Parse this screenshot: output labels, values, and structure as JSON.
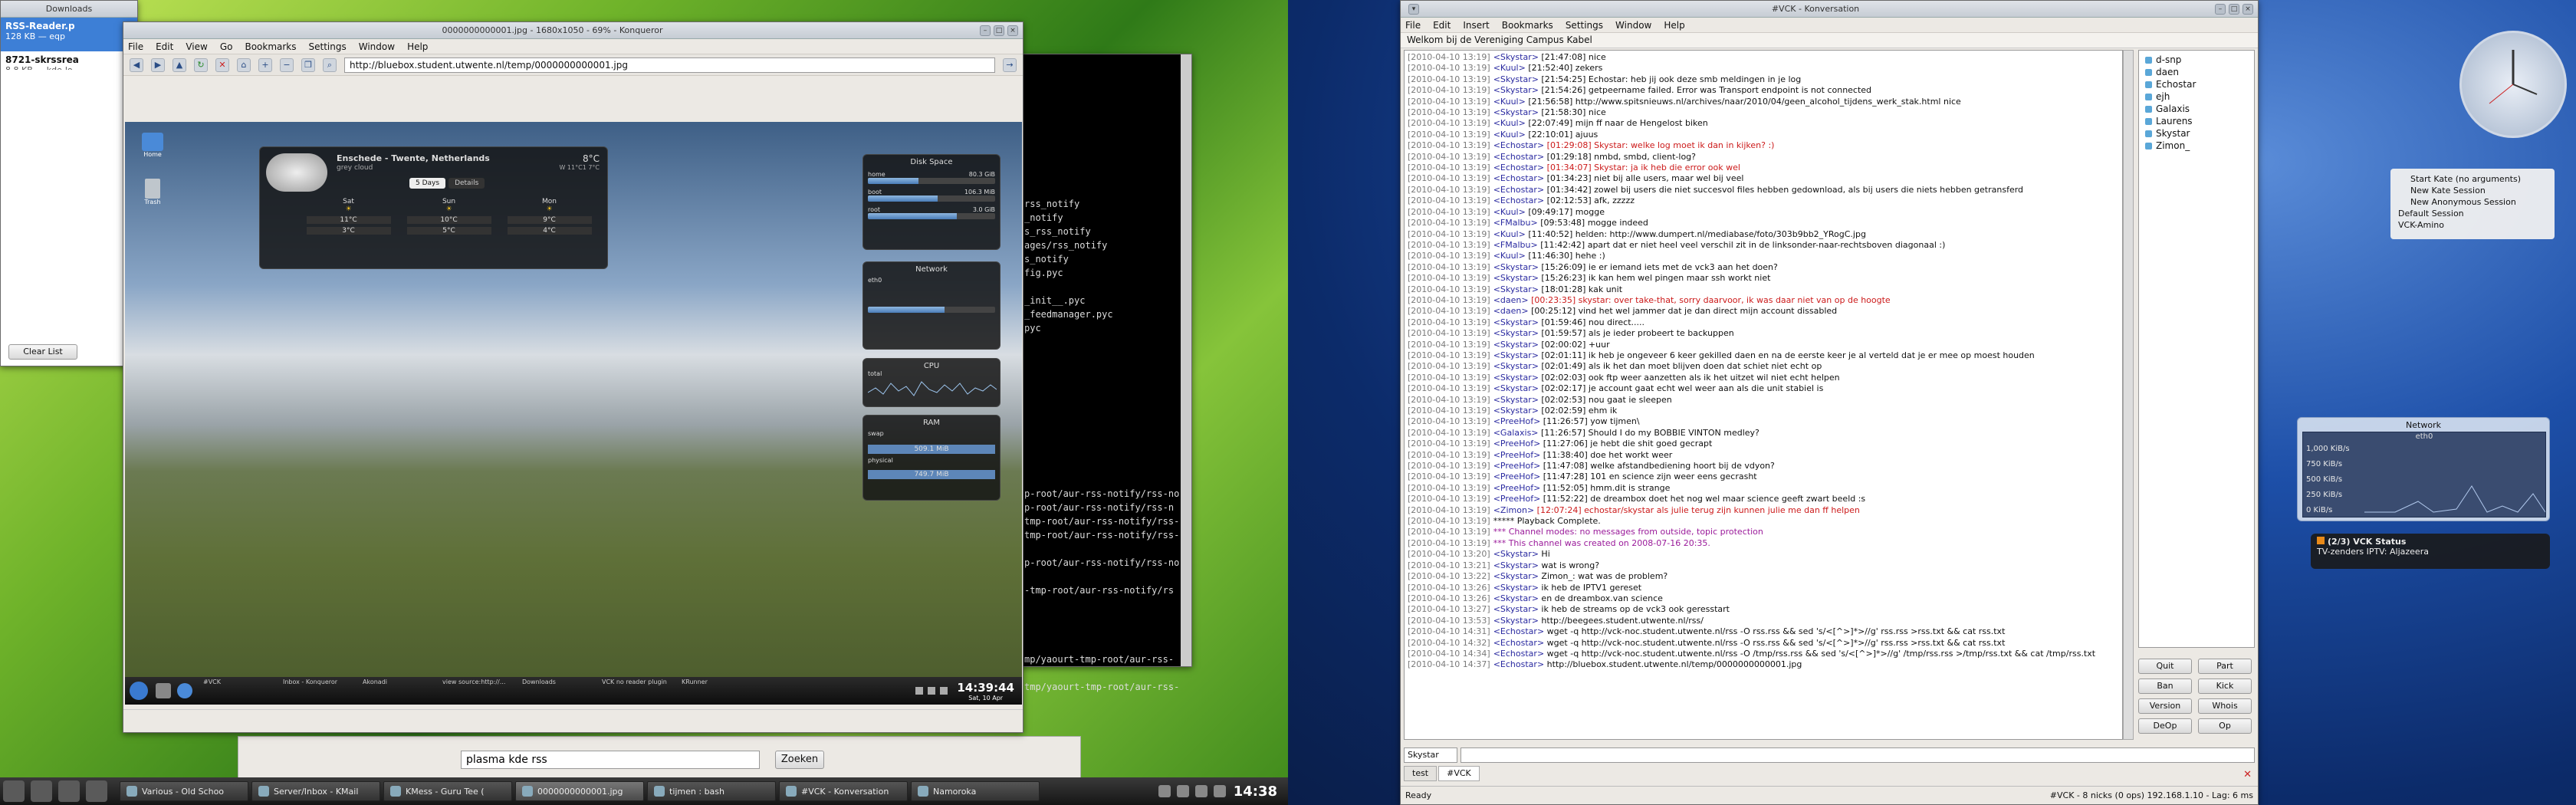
{
  "downloads": {
    "title": "Downloads",
    "items": [
      {
        "name": "RSS-Reader.p",
        "size": "128 KB — eqp"
      },
      {
        "name": "8721-skrssrea",
        "size": "8.8 KB — kde-lo"
      }
    ],
    "clear_label": "Clear List"
  },
  "konqueror": {
    "title": "0000000000001.jpg - 1680x1050 - 69% - Konqueror",
    "menu": [
      "File",
      "Edit",
      "View",
      "Go",
      "Bookmarks",
      "Settings",
      "Window",
      "Help"
    ],
    "url": "http://bluebox.student.utwente.nl/temp/0000000000001.jpg"
  },
  "thumb": {
    "weather": {
      "location": "Enschede - Twente, Netherlands",
      "condition": "grey cloud",
      "temp": "8°C",
      "wind": "W 11°C1 7°C",
      "tab1": "5 Days",
      "tab2": "Details",
      "days": [
        {
          "d": "Sat",
          "hi": "11°C",
          "lo": "3°C"
        },
        {
          "d": "Sun",
          "hi": "10°C",
          "lo": "5°C"
        },
        {
          "d": "Mon",
          "hi": "9°C",
          "lo": "4°C"
        }
      ]
    },
    "disk": {
      "title": "Disk Space",
      "rows": [
        {
          "n": "home",
          "v": "80.3 GiB"
        },
        {
          "n": "boot",
          "v": "106.3 MiB"
        },
        {
          "n": "root",
          "v": "3.0 GiB"
        }
      ]
    },
    "network": {
      "title": "Network",
      "label1": "eth0"
    },
    "cpu": {
      "title": "CPU",
      "label": "total"
    },
    "ram": {
      "title": "RAM",
      "swap": "swap",
      "swapv": "509.1 MiB",
      "physical": "physical",
      "physv": "749.7 MiB"
    },
    "clock": "14:39:44",
    "date": "Sat, 10 Apr",
    "trash": "Trash",
    "home": "Home",
    "tasks": [
      "#VCK",
      "Inbox - Konqueror",
      "Akonadi",
      "view source:http://...",
      "Downloads",
      "VCK no reader plugin",
      "KRunner"
    ]
  },
  "terminal": {
    "lines": [
      "rss_notify",
      "_notify",
      "s_rss_notify",
      "ages/rss_notify",
      "s_notify",
      "fig.pyc",
      "",
      "_init__.pyc",
      "_feedmanager.pyc",
      "pyc",
      "",
      "",
      "",
      "",
      "",
      "",
      "",
      "",
      "",
      "",
      "",
      "p-root/aur-rss-notify/rss-no",
      "p-root/aur-rss-notify/rss-n",
      "tmp-root/aur-rss-notify/rss-",
      "tmp-root/aur-rss-notify/rss-",
      "",
      "p-root/aur-rss-notify/rss-no",
      "",
      "-tmp-root/aur-rss-notify/rs",
      "",
      "",
      "",
      "",
      "mp/yaourt-tmp-root/aur-rss-",
      "",
      "tmp/yaourt-tmp-root/aur-rss-"
    ]
  },
  "search": {
    "value": "plasma kde rss",
    "button": "Zoeken"
  },
  "left_panel": {
    "tasks": [
      "Various - Old Schoo",
      "Server/Inbox - KMail",
      "KMess - Guru Tee (",
      "0000000000001.jpg",
      "tijmen : bash",
      "#VCK - Konversation",
      "Namoroka"
    ],
    "clock": "14:38"
  },
  "konversation": {
    "title": "#VCK - Konversation",
    "menu": [
      "File",
      "Edit",
      "Insert",
      "Bookmarks",
      "Settings",
      "Window",
      "Help"
    ],
    "topic": "Welkom bij de Vereniging Campus Kabel",
    "lines": [
      {
        "t": "[2010-04-10 13:19]",
        "n": "<Skystar>",
        "m": " [21:47:08] nice",
        "c": ""
      },
      {
        "t": "[2010-04-10 13:19]",
        "n": "<Kuul>",
        "m": " [21:52:40] zekers",
        "c": ""
      },
      {
        "t": "[2010-04-10 13:19]",
        "n": "<Skystar>",
        "m": " [21:54:25] Echostar: heb jij ook deze smb meldingen in je log",
        "c": ""
      },
      {
        "t": "[2010-04-10 13:19]",
        "n": "<Skystar>",
        "m": " [21:54:26] getpeername failed. Error was Transport endpoint is not connected",
        "c": ""
      },
      {
        "t": "[2010-04-10 13:19]",
        "n": "<Kuul>",
        "m": " [21:56:58] http://www.spitsnieuws.nl/archives/naar/2010/04/geen_alcohol_tijdens_werk_stak.html nice",
        "c": ""
      },
      {
        "t": "[2010-04-10 13:19]",
        "n": "<Skystar>",
        "m": " [21:58:30] nice",
        "c": ""
      },
      {
        "t": "[2010-04-10 13:19]",
        "n": "<Kuul>",
        "m": " [22:07:49] mijn ff naar de Hengelost biken",
        "c": ""
      },
      {
        "t": "[2010-04-10 13:19]",
        "n": "<Kuul>",
        "m": " [22:10:01] ajuus",
        "c": ""
      },
      {
        "t": "[2010-04-10 13:19]",
        "n": "<Echostar>",
        "m": " [01:29:08] Skystar: welke log moet ik dan in kijken? :)",
        "c": "red"
      },
      {
        "t": "[2010-04-10 13:19]",
        "n": "<Echostar>",
        "m": " [01:29:18] nmbd, smbd, client-log?",
        "c": ""
      },
      {
        "t": "[2010-04-10 13:19]",
        "n": "<Echostar>",
        "m": " [01:34:07] Skystar: ja ik heb die error ook wel",
        "c": "red"
      },
      {
        "t": "[2010-04-10 13:19]",
        "n": "<Echostar>",
        "m": " [01:34:23] niet bij alle users, maar wel bij veel",
        "c": ""
      },
      {
        "t": "[2010-04-10 13:19]",
        "n": "<Echostar>",
        "m": " [01:34:42] zowel bij users die niet succesvol files hebben gedownload, als bij users die niets hebben getransferd",
        "c": ""
      },
      {
        "t": "[2010-04-10 13:19]",
        "n": "<Echostar>",
        "m": " [02:12:53] afk, zzzzz",
        "c": ""
      },
      {
        "t": "[2010-04-10 13:19]",
        "n": "<Kuul>",
        "m": " [09:49:17] mogge",
        "c": ""
      },
      {
        "t": "[2010-04-10 13:19]",
        "n": "<FMalbu>",
        "m": " [09:53:48] mogge indeed",
        "c": ""
      },
      {
        "t": "[2010-04-10 13:19]",
        "n": "<Kuul>",
        "m": " [11:40:52] helden: http://www.dumpert.nl/mediabase/foto/303b9bb2_YRogC.jpg",
        "c": ""
      },
      {
        "t": "[2010-04-10 13:19]",
        "n": "<FMalbu>",
        "m": " [11:42:42] apart dat er niet heel veel verschil zit in de linksonder-naar-rechtsboven diagonaal :)",
        "c": ""
      },
      {
        "t": "[2010-04-10 13:19]",
        "n": "<Kuul>",
        "m": " [11:46:30] hehe :)",
        "c": ""
      },
      {
        "t": "[2010-04-10 13:19]",
        "n": "<Skystar>",
        "m": " [15:26:09] ie er iemand iets met de vck3 aan het doen?",
        "c": ""
      },
      {
        "t": "[2010-04-10 13:19]",
        "n": "<Skystar>",
        "m": " [15:26:23] ik kan hem wel pingen maar ssh workt niet",
        "c": ""
      },
      {
        "t": "[2010-04-10 13:19]",
        "n": "<Skystar>",
        "m": " [18:01:28] kak unit",
        "c": ""
      },
      {
        "t": "[2010-04-10 13:19]",
        "n": "<daen>",
        "m": " [00:23:35] skystar: over take-that, sorry daarvoor, ik was daar niet van op de hoogte",
        "c": "red"
      },
      {
        "t": "[2010-04-10 13:19]",
        "n": "<daen>",
        "m": " [00:25:12] vind het wel jammer dat je dan direct mijn account dissabled",
        "c": ""
      },
      {
        "t": "[2010-04-10 13:19]",
        "n": "<Skystar>",
        "m": " [01:59:46] nou direct.....",
        "c": ""
      },
      {
        "t": "[2010-04-10 13:19]",
        "n": "<Skystar>",
        "m": " [01:59:57] als je ieder probeert te backuppen",
        "c": ""
      },
      {
        "t": "[2010-04-10 13:19]",
        "n": "<Skystar>",
        "m": " [02:00:02] +uur",
        "c": ""
      },
      {
        "t": "[2010-04-10 13:19]",
        "n": "<Skystar>",
        "m": " [02:01:11] ik heb je ongeveer 6 keer gekilled daen en na de eerste keer je al verteld dat je er mee op moest houden",
        "c": ""
      },
      {
        "t": "[2010-04-10 13:19]",
        "n": "<Skystar>",
        "m": " [02:01:49] als ik het dan moet blijven doen dat schiet niet echt op",
        "c": ""
      },
      {
        "t": "[2010-04-10 13:19]",
        "n": "<Skystar>",
        "m": " [02:02:03] ook ftp weer aanzetten als ik het uitzet wil niet echt helpen",
        "c": ""
      },
      {
        "t": "[2010-04-10 13:19]",
        "n": "<Skystar>",
        "m": " [02:02:17] je account gaat echt wel weer aan als die unit stabiel is",
        "c": ""
      },
      {
        "t": "[2010-04-10 13:19]",
        "n": "<Skystar>",
        "m": " [02:02:53] nou gaat ie sleepen",
        "c": ""
      },
      {
        "t": "[2010-04-10 13:19]",
        "n": "<Skystar>",
        "m": " [02:02:59] ehm ik",
        "c": ""
      },
      {
        "t": "[2010-04-10 13:19]",
        "n": "<PreeHof>",
        "m": " [11:26:57] yow tijmen\\",
        "c": ""
      },
      {
        "t": "[2010-04-10 13:19]",
        "n": "<Galaxis>",
        "m": " [11:26:57] Should I do my BOBBIE VINTON medley?",
        "c": ""
      },
      {
        "t": "[2010-04-10 13:19]",
        "n": "<PreeHof>",
        "m": " [11:27:06] je hebt die shit goed gecrapt",
        "c": ""
      },
      {
        "t": "[2010-04-10 13:19]",
        "n": "<PreeHof>",
        "m": " [11:38:40] doe het workt weer",
        "c": ""
      },
      {
        "t": "[2010-04-10 13:19]",
        "n": "<PreeHof>",
        "m": " [11:47:08] welke afstandbediening hoort bij de vdyon?",
        "c": ""
      },
      {
        "t": "[2010-04-10 13:19]",
        "n": "<PreeHof>",
        "m": " [11:47:28] 101 en science zijn weer eens gecrasht",
        "c": ""
      },
      {
        "t": "[2010-04-10 13:19]",
        "n": "<PreeHof>",
        "m": " [11:52:05] hmm.dit is strange",
        "c": ""
      },
      {
        "t": "[2010-04-10 13:19]",
        "n": "<PreeHof>",
        "m": " [11:52:22] de dreambox doet het nog wel maar science geeft zwart beeld :s",
        "c": ""
      },
      {
        "t": "[2010-04-10 13:19]",
        "n": "<Zimon>",
        "m": " [12:07:24] echostar/skystar als julie terug zijn kunnen julie me dan ff helpen",
        "c": "red"
      },
      {
        "t": "[2010-04-10 13:19]",
        "n": "",
        "m": "***** Playback Complete.",
        "c": ""
      },
      {
        "t": "[2010-04-10 13:19]",
        "n": "",
        "m": "*** Channel modes: no messages from outside, topic protection",
        "c": "pur"
      },
      {
        "t": "[2010-04-10 13:19]",
        "n": "",
        "m": "*** This channel was created on 2008-07-16 20:35.",
        "c": "pur"
      },
      {
        "t": "[2010-04-10 13:20]",
        "n": "<Skystar>",
        "m": " Hi",
        "c": ""
      },
      {
        "t": "[2010-04-10 13:21]",
        "n": "<Skystar>",
        "m": " wat is wrong?",
        "c": ""
      },
      {
        "t": "[2010-04-10 13:22]",
        "n": "<Skystar>",
        "m": " Zimon_: wat was de problem?",
        "c": ""
      },
      {
        "t": "[2010-04-10 13:26]",
        "n": "<Skystar>",
        "m": " ik heb de IPTV1 gereset",
        "c": ""
      },
      {
        "t": "[2010-04-10 13:26]",
        "n": "<Skystar>",
        "m": " en de dreambox.van science",
        "c": ""
      },
      {
        "t": "[2010-04-10 13:27]",
        "n": "<Skystar>",
        "m": " ik heb de streams op de vck3 ook geresstart",
        "c": ""
      },
      {
        "t": "[2010-04-10 13:53]",
        "n": "<Skystar>",
        "m": " http://beegees.student.utwente.nl/rss/",
        "c": ""
      },
      {
        "t": "[2010-04-10 14:31]",
        "n": "<Echostar>",
        "m": " wget -q http://vck-noc.student.utwente.nl/rss -O rss.rss && sed 's/<[^>]*>//g' rss.rss >rss.txt && cat rss.txt",
        "c": ""
      },
      {
        "t": "[2010-04-10 14:32]",
        "n": "<Echostar>",
        "m": " wget -q http://vck-noc.student.utwente.nl/rss -O rss.rss && sed 's/<[^>]*>//g' rss.rss >rss.txt && cat rss.txt",
        "c": ""
      },
      {
        "t": "[2010-04-10 14:34]",
        "n": "<Echostar>",
        "m": " wget -q http://vck-noc.student.utwente.nl/rss -O /tmp/rss.rss && sed 's/<[^>]*>//g' /tmp/rss.rss >/tmp/rss.txt && cat /tmp/rss.txt",
        "c": ""
      },
      {
        "t": "[2010-04-10 14:37]",
        "n": "<Echostar>",
        "m": " http://bluebox.student.utwente.nl/temp/0000000000001.jpg",
        "c": ""
      }
    ],
    "nicks": [
      "d-snp",
      "daen",
      "Echostar",
      "ejh",
      "Galaxis",
      "Laurens",
      "Skystar",
      "Zimon_"
    ],
    "buttons": [
      "Quit",
      "Part",
      "Ban",
      "Kick",
      "Version",
      "Whois",
      "DeOp",
      "Op"
    ],
    "nick_select": "Skystar",
    "tabs": [
      "test",
      "#VCK"
    ],
    "status_left": "Ready",
    "status_right": "#VCK - 8 nicks (0 ops)  192.168.1.10 - Lag: 6 ms"
  },
  "right_widgets": {
    "launcher": [
      "Start Kate (no arguments)",
      "New Kate Session",
      "New Anonymous Session",
      "Default Session",
      "VCK-Amino"
    ],
    "network_title": "Network",
    "network_if": "eth0",
    "network_scale": [
      "1,000 KiB/s",
      "750 KiB/s",
      "500 KiB/s",
      "250 KiB/s",
      "0 KiB/s"
    ],
    "notify_title": "(2/3) VCK Status",
    "notify_body": "TV-zenders IPTV: Aljazeera"
  },
  "colors": {
    "accent": "#2a5db0",
    "chat_red": "#cc1a1a",
    "chat_purple": "#9a1a9a"
  }
}
